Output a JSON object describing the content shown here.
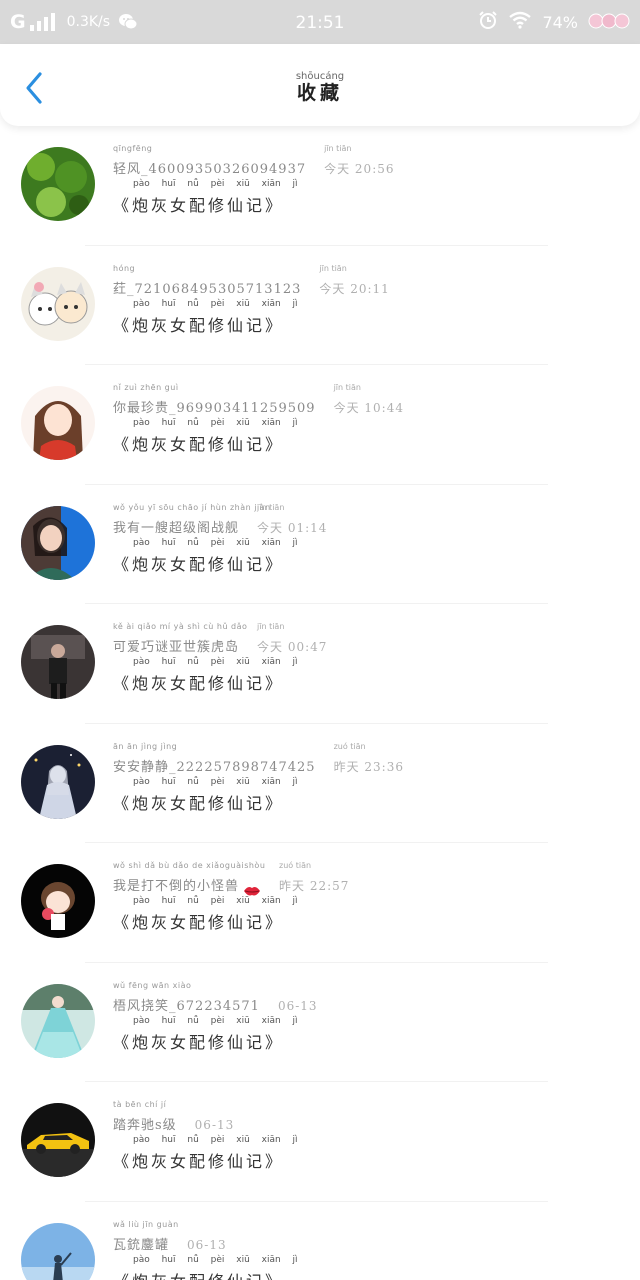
{
  "status_bar": {
    "network": "G",
    "speed": "0.3K/s",
    "time": "21:51",
    "battery": "74%"
  },
  "header": {
    "title_pinyin": "shōucáng",
    "title": "收藏"
  },
  "book_pinyin": "pào huī nǚ pèi xiū xiān jì",
  "items": [
    {
      "name_pinyin": "qīngfēng",
      "name": "轻风_46009350326094937",
      "time_pinyin": "jīn tiān",
      "time": "今天 20:56",
      "book": "《炮灰女配修仙记》",
      "avatar": "leaves"
    },
    {
      "name_pinyin": "hóng",
      "name": "荭_721068495305713123",
      "time_pinyin": "jīn tiān",
      "time": "今天 20:11",
      "book": "《炮灰女配修仙记》",
      "avatar": "cats"
    },
    {
      "name_pinyin": "nǐ zuì zhēn guì",
      "name": "你最珍贵_969903411259509",
      "time_pinyin": "jīn tiān",
      "time": "今天 10:44",
      "book": "《炮灰女配修仙记》",
      "avatar": "anime-girl"
    },
    {
      "name_pinyin": "wǒ yǒu yī sōu chāo jí hùn zhàn jiàn",
      "name": "我有一艘超级阁战舰",
      "time_pinyin": "jīn tiān",
      "time": "今天 01:14",
      "book": "《炮灰女配修仙记》",
      "avatar": "girl-photo"
    },
    {
      "name_pinyin": "kě ài qiǎo mí yà shì cù hǔ dǎo",
      "name": "可爱巧谜亚世簇虎岛",
      "time_pinyin": "jīn tiān",
      "time": "今天 00:47",
      "book": "《炮灰女配修仙记》",
      "avatar": "man-dark"
    },
    {
      "name_pinyin": "ān ān jìng jìng",
      "name": "安安静静_222257898747425",
      "time_pinyin": "zuó tiān",
      "time": "昨天 23:36",
      "book": "《炮灰女配修仙记》",
      "avatar": "night-girl"
    },
    {
      "name_pinyin": "wǒ shì dǎ bù dǎo de xiǎoguàishòu",
      "name": "我是打不倒的小怪兽",
      "time_pinyin": "zuó tiān",
      "time": "昨天 22:57",
      "book": "《炮灰女配修仙记》",
      "avatar": "chibi-black",
      "lips": true
    },
    {
      "name_pinyin": "wǔ fēng wān xiào",
      "name": "梧风挠笑_672234571",
      "time_pinyin": "",
      "time": "06-13",
      "book": "《炮灰女配修仙记》",
      "avatar": "hanfu"
    },
    {
      "name_pinyin": "tà bēn chí jí",
      "name": "踏奔驰s级",
      "time_pinyin": "",
      "time": "06-13",
      "book": "《炮灰女配修仙记》",
      "avatar": "car"
    },
    {
      "name_pinyin": "wǎ liù jīn guàn",
      "name": "瓦銃鏖罐",
      "time_pinyin": "",
      "time": "06-13",
      "book": "《炮灰女配修仙记》",
      "avatar": "sky"
    }
  ]
}
